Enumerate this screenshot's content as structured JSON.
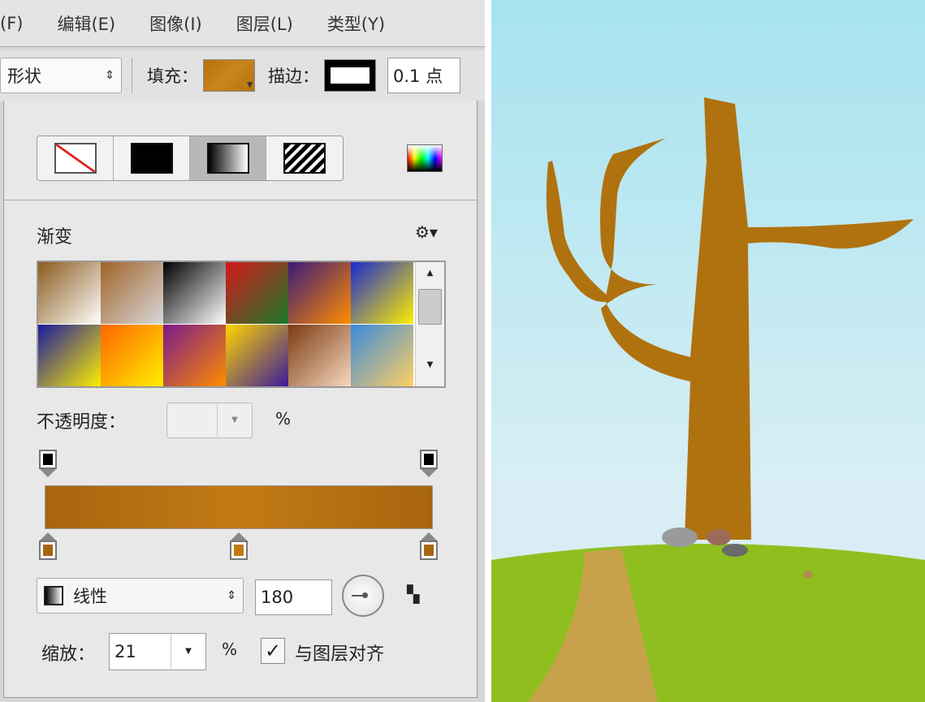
{
  "menu": [
    "(F)",
    "编辑(E)",
    "图像(I)",
    "图层(L)",
    "类型(Y)"
  ],
  "toolbar": {
    "mode": "形状",
    "fill_label": "填充：",
    "stroke_label": "描边：",
    "stroke_width": "0.1 点",
    "fill_color": "#b7720f"
  },
  "panel": {
    "fill_types": [
      "none",
      "solid",
      "gradient",
      "pattern"
    ],
    "active_fill_type": "gradient",
    "section_title": "渐变",
    "gradients": [
      [
        "#8a5a1a",
        "#ffffff"
      ],
      [
        "#a0622a",
        "#d8d8d8"
      ],
      [
        "#000000",
        "#ffffff"
      ],
      [
        "#d4181c",
        "#1a7a2a"
      ],
      [
        "#3a1a7a",
        "#ff8c00"
      ],
      [
        "#1a2ad0",
        "#ffee00"
      ],
      [
        "#1a1aa0",
        "#ffee00"
      ],
      [
        "#ff6600",
        "#ffee00"
      ],
      [
        "#7a1a8a",
        "#ff8c00"
      ],
      [
        "#ffd400",
        "#3a1a9a"
      ],
      [
        "#7a3a10",
        "#f7d8c0"
      ],
      [
        "#3a8ade",
        "#ffd060"
      ]
    ],
    "opacity_label": "不透明度：",
    "opacity_value": "",
    "percent": "%",
    "gradient_colors": [
      "#a8650f",
      "#c17a14",
      "#a8650f"
    ],
    "type_label": "线性",
    "angle": "180",
    "scale_label": "缩放：",
    "scale_value": "21",
    "align_label": "与图层对齐",
    "align_checked": true
  }
}
